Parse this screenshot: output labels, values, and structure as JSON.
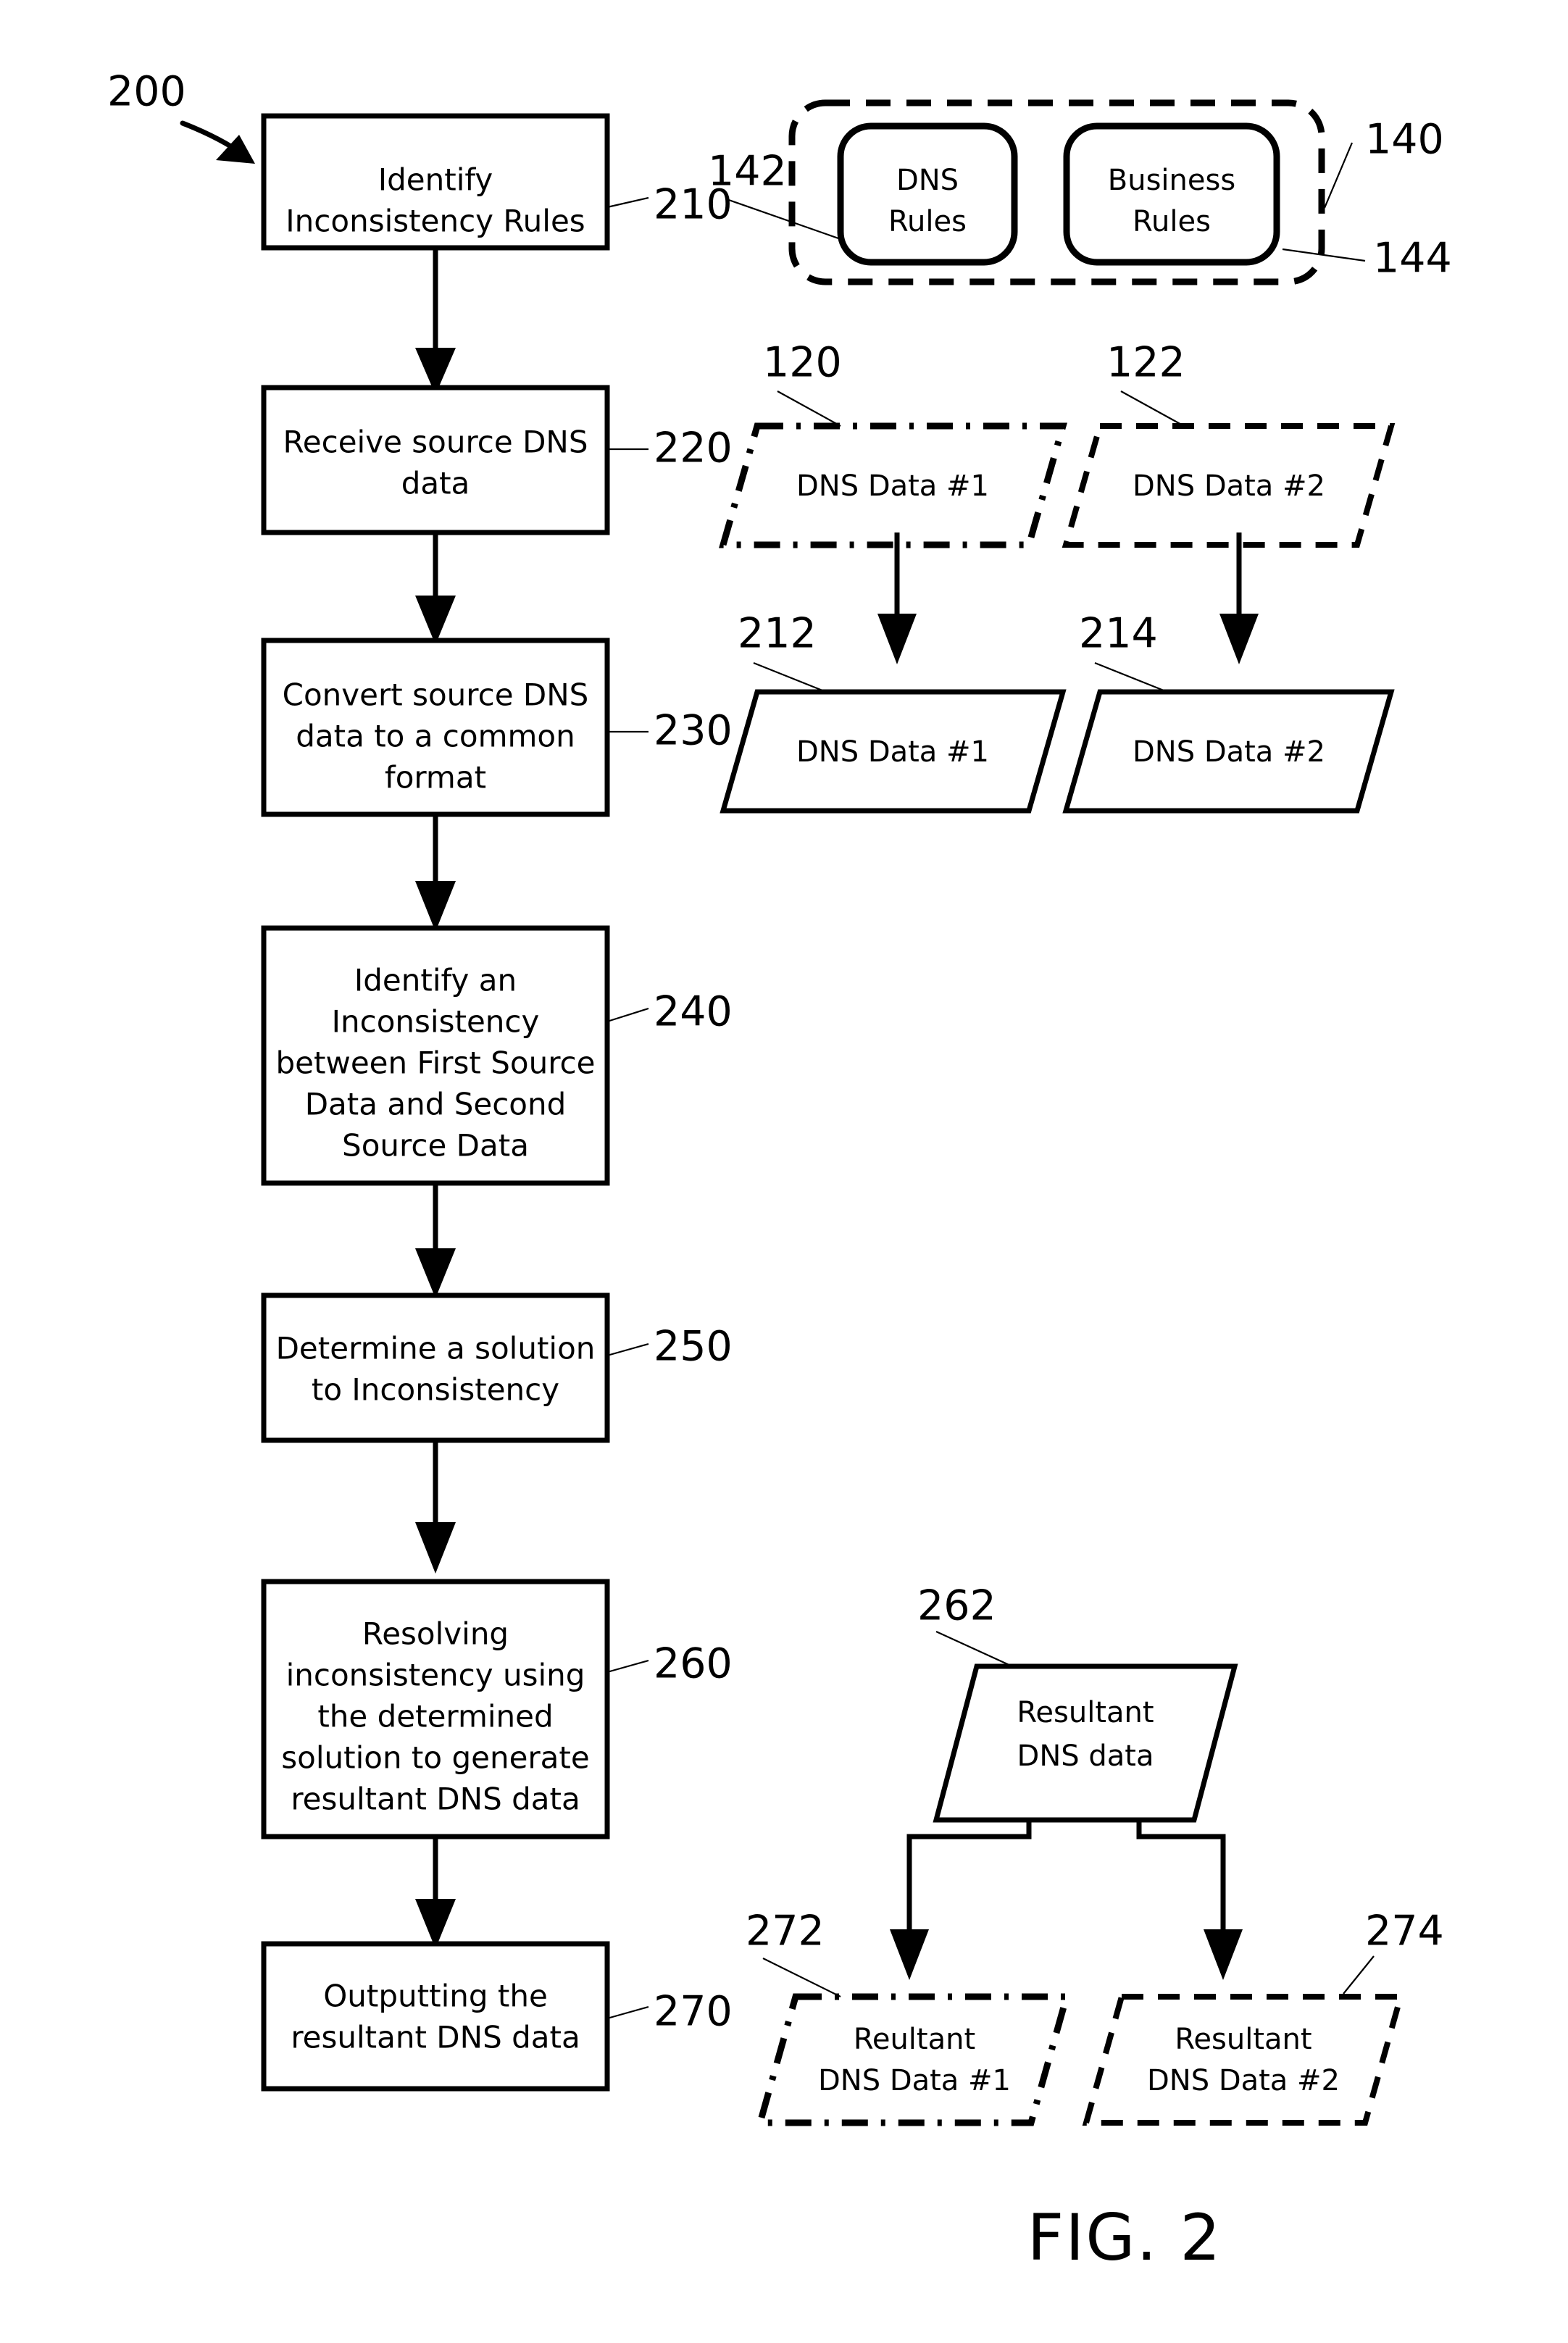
{
  "figure": {
    "caption": "FIG. 2",
    "diagram_ref": "200"
  },
  "flowchart": {
    "steps": [
      {
        "ref": "210",
        "lines": [
          "Identify",
          "Inconsistency Rules"
        ]
      },
      {
        "ref": "220",
        "lines": [
          "Receive source DNS",
          "data"
        ]
      },
      {
        "ref": "230",
        "lines": [
          "Convert source DNS",
          "data to a common",
          "format"
        ]
      },
      {
        "ref": "240",
        "lines": [
          "Identify an",
          "Inconsistency",
          "between First Source",
          "Data and Second",
          "Source Data"
        ]
      },
      {
        "ref": "250",
        "lines": [
          "Determine a solution",
          "to Inconsistency"
        ]
      },
      {
        "ref": "260",
        "lines": [
          "Resolving",
          "inconsistency using",
          "the determined",
          "solution to generate",
          "resultant DNS data"
        ]
      },
      {
        "ref": "270",
        "lines": [
          "Outputting the",
          "resultant DNS data"
        ]
      }
    ]
  },
  "rules_group": {
    "ref": "140",
    "container_ref_left": "142",
    "container_ref_right_lower": "144",
    "items": [
      {
        "ref": "142",
        "lines": [
          "DNS",
          "Rules"
        ]
      },
      {
        "ref": "144",
        "lines": [
          "Business",
          "Rules"
        ]
      }
    ]
  },
  "source_data": {
    "inputs": [
      {
        "ref": "120",
        "label": "DNS Data #1",
        "border": "dash-dot"
      },
      {
        "ref": "122",
        "label": "DNS Data #2",
        "border": "dashed"
      }
    ],
    "converted": [
      {
        "ref": "212",
        "label": "DNS Data #1",
        "border": "solid"
      },
      {
        "ref": "214",
        "label": "DNS Data #2",
        "border": "solid"
      }
    ]
  },
  "resultant": {
    "source": {
      "ref": "262",
      "lines": [
        "Resultant",
        "DNS data"
      ],
      "border": "solid"
    },
    "outputs": [
      {
        "ref": "272",
        "lines": [
          "Reultant",
          "DNS Data #1"
        ],
        "border": "dash-dot"
      },
      {
        "ref": "274",
        "lines": [
          "Resultant",
          "DNS Data #2"
        ],
        "border": "dashed"
      }
    ]
  },
  "colors": {
    "stroke": "#000000",
    "fill": "#ffffff"
  }
}
